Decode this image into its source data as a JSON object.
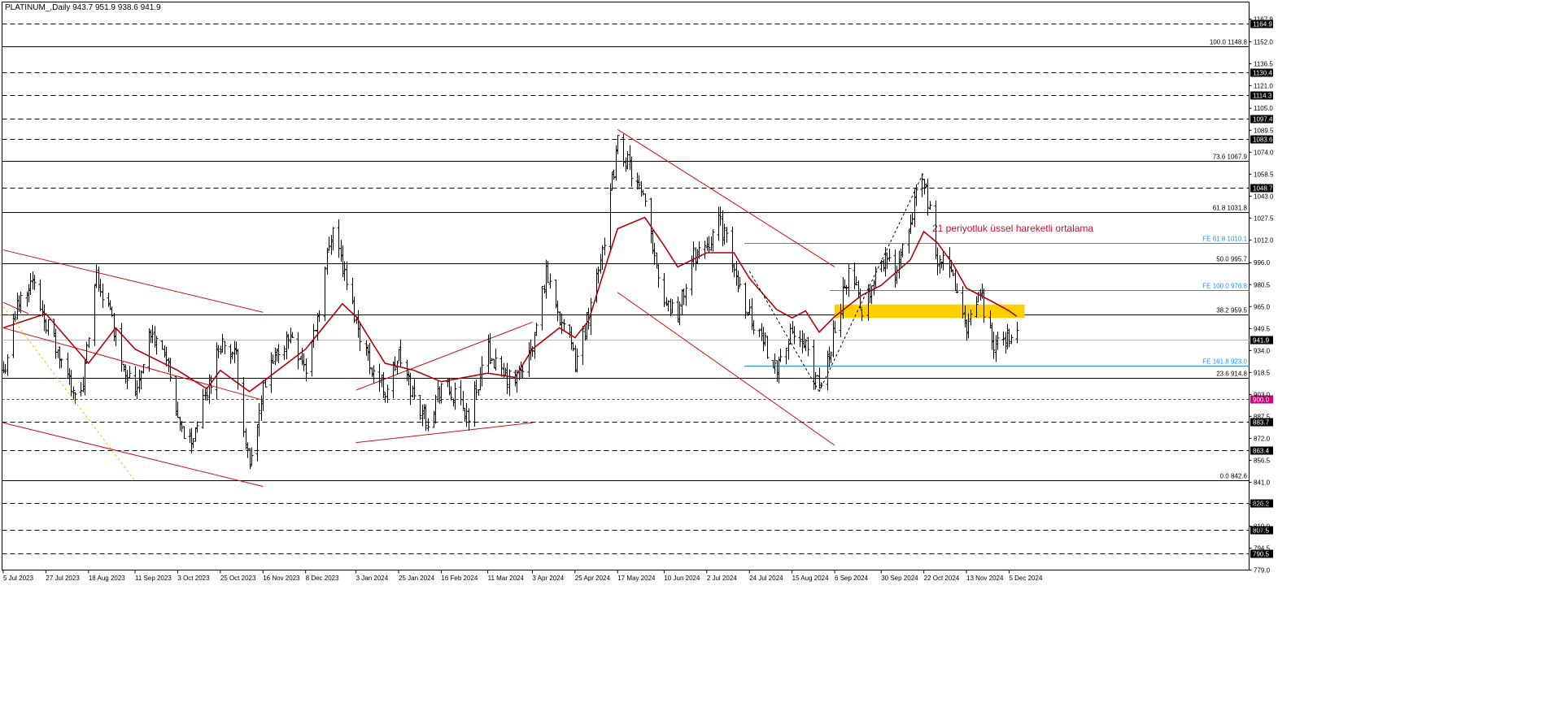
{
  "header": {
    "symbol_line": "PLATINUM_,Daily  943.7 951.9 938.6 941.9"
  },
  "annotation": "21 periyotluk üssel hareketli ortalama",
  "colors": {
    "price_bars": "#000000",
    "ema": "#b3000c",
    "trendlines": "#d01010",
    "fib": "#000000",
    "fe": "#1e90ff",
    "zone": "#ffd000",
    "level_900": "#d0007a"
  },
  "chart_data": {
    "type": "ohlc",
    "symbol": "PLATINUM_",
    "timeframe": "Daily",
    "last_bar": {
      "open": 943.7,
      "high": 951.9,
      "low": 938.6,
      "close": 941.9
    },
    "current_price": 941.9,
    "ylim": [
      779.0,
      1180.0
    ],
    "y_ticks": [
      "1167.9",
      "1152.0",
      "1136.5",
      "1121.0",
      "1105.0",
      "1089.5",
      "1074.0",
      "1058.5",
      "1043.0",
      "1027.5",
      "1012.0",
      "996.0",
      "980.5",
      "965.0",
      "949.5",
      "934.0",
      "918.5",
      "903.0",
      "887.5",
      "872.0",
      "856.5",
      "841.0",
      "825.5",
      "810.0",
      "794.5",
      "779.0"
    ],
    "x_ticks": [
      "5 Jul 2023",
      "27 Jul 2023",
      "18 Aug 2023",
      "11 Sep 2023",
      "3 Oct 2023",
      "25 Oct 2023",
      "16 Nov 2023",
      "8 Dec 2023",
      "3 Jan 2024",
      "25 Jan 2024",
      "16 Feb 2024",
      "11 Mar 2024",
      "3 Apr 2024",
      "25 Apr 2024",
      "17 May 2024",
      "10 Jun 2024",
      "2 Jul 2024",
      "24 Jul 2024",
      "15 Aug 2024",
      "6 Sep 2024",
      "30 Sep 2024",
      "22 Oct 2024",
      "13 Nov 2024",
      "5 Dec 2024"
    ],
    "price_path": [
      [
        "5 Jul 2023",
        918
      ],
      [
        "12 Jul 2023",
        965
      ],
      [
        "19 Jul 2023",
        985
      ],
      [
        "27 Jul 2023",
        955
      ],
      [
        "5 Aug 2023",
        920
      ],
      [
        "14 Aug 2023",
        900
      ],
      [
        "22 Aug 2023",
        985
      ],
      [
        "29 Aug 2023",
        960
      ],
      [
        "5 Sep 2023",
        925
      ],
      [
        "11 Sep 2023",
        905
      ],
      [
        "18 Sep 2023",
        945
      ],
      [
        "26 Sep 2023",
        935
      ],
      [
        "3 Oct 2023",
        880
      ],
      [
        "10 Oct 2023",
        870
      ],
      [
        "18 Oct 2023",
        905
      ],
      [
        "25 Oct 2023",
        940
      ],
      [
        "2 Nov 2023",
        928
      ],
      [
        "9 Nov 2023",
        848
      ],
      [
        "16 Nov 2023",
        905
      ],
      [
        "24 Nov 2023",
        935
      ],
      [
        "1 Dec 2023",
        945
      ],
      [
        "8 Dec 2023",
        920
      ],
      [
        "15 Dec 2023",
        965
      ],
      [
        "22 Dec 2023",
        1025
      ],
      [
        "29 Dec 2023",
        980
      ],
      [
        "3 Jan 2024",
        955
      ],
      [
        "10 Jan 2024",
        925
      ],
      [
        "18 Jan 2024",
        905
      ],
      [
        "25 Jan 2024",
        930
      ],
      [
        "2 Feb 2024",
        900
      ],
      [
        "9 Feb 2024",
        885
      ],
      [
        "16 Feb 2024",
        910
      ],
      [
        "23 Feb 2024",
        900
      ],
      [
        "1 Mar 2024",
        888
      ],
      [
        "11 Mar 2024",
        935
      ],
      [
        "18 Mar 2024",
        915
      ],
      [
        "25 Mar 2024",
        912
      ],
      [
        "3 Apr 2024",
        935
      ],
      [
        "10 Apr 2024",
        990
      ],
      [
        "17 Apr 2024",
        960
      ],
      [
        "25 Apr 2024",
        925
      ],
      [
        "2 May 2024",
        960
      ],
      [
        "10 May 2024",
        1015
      ],
      [
        "17 May 2024",
        1080
      ],
      [
        "24 May 2024",
        1060
      ],
      [
        "31 May 2024",
        1035
      ],
      [
        "10 Jun 2024",
        970
      ],
      [
        "17 Jun 2024",
        960
      ],
      [
        "25 Jun 2024",
        1000
      ],
      [
        "2 Jul 2024",
        1010
      ],
      [
        "9 Jul 2024",
        1025
      ],
      [
        "16 Jul 2024",
        990
      ],
      [
        "24 Jul 2024",
        960
      ],
      [
        "31 Jul 2024",
        940
      ],
      [
        "7 Aug 2024",
        925
      ],
      [
        "15 Aug 2024",
        945
      ],
      [
        "22 Aug 2024",
        935
      ],
      [
        "29 Aug 2024",
        905
      ],
      [
        "6 Sep 2024",
        950
      ],
      [
        "13 Sep 2024",
        990
      ],
      [
        "20 Sep 2024",
        965
      ],
      [
        "30 Sep 2024",
        1000
      ],
      [
        "7 Oct 2024",
        990
      ],
      [
        "15 Oct 2024",
        1030
      ],
      [
        "22 Oct 2024",
        1055
      ],
      [
        "29 Oct 2024",
        1000
      ],
      [
        "6 Nov 2024",
        985
      ],
      [
        "13 Nov 2024",
        945
      ],
      [
        "20 Nov 2024",
        975
      ],
      [
        "27 Nov 2024",
        935
      ],
      [
        "5 Dec 2024",
        945
      ],
      [
        "9 Dec 2024",
        941.9
      ]
    ],
    "ema_series": {
      "period": 21,
      "path": [
        [
          "5 Jul 2023",
          950
        ],
        [
          "27 Jul 2023",
          960
        ],
        [
          "18 Aug 2023",
          925
        ],
        [
          "1 Sep 2023",
          950
        ],
        [
          "11 Sep 2023",
          935
        ],
        [
          "3 Oct 2023",
          920
        ],
        [
          "18 Oct 2023",
          907
        ],
        [
          "25 Oct 2023",
          920
        ],
        [
          "9 Nov 2023",
          905
        ],
        [
          "16 Nov 2023",
          912
        ],
        [
          "8 Dec 2023",
          935
        ],
        [
          "27 Dec 2023",
          967
        ],
        [
          "3 Jan 2024",
          958
        ],
        [
          "18 Jan 2024",
          925
        ],
        [
          "2 Feb 2024",
          920
        ],
        [
          "16 Feb 2024",
          912
        ],
        [
          "11 Mar 2024",
          918
        ],
        [
          "25 Mar 2024",
          915
        ],
        [
          "3 Apr 2024",
          935
        ],
        [
          "17 Apr 2024",
          950
        ],
        [
          "25 Apr 2024",
          943
        ],
        [
          "2 May 2024",
          955
        ],
        [
          "10 May 2024",
          990
        ],
        [
          "17 May 2024",
          1020
        ],
        [
          "31 May 2024",
          1028
        ],
        [
          "10 Jun 2024",
          1008
        ],
        [
          "17 Jun 2024",
          993
        ],
        [
          "2 Jul 2024",
          1003
        ],
        [
          "16 Jul 2024",
          1003
        ],
        [
          "24 Jul 2024",
          985
        ],
        [
          "7 Aug 2024",
          963
        ],
        [
          "15 Aug 2024",
          957
        ],
        [
          "22 Aug 2024",
          962
        ],
        [
          "29 Aug 2024",
          947
        ],
        [
          "6 Sep 2024",
          958
        ],
        [
          "20 Sep 2024",
          973
        ],
        [
          "30 Sep 2024",
          980
        ],
        [
          "15 Oct 2024",
          998
        ],
        [
          "22 Oct 2024",
          1018
        ],
        [
          "29 Oct 2024",
          1010
        ],
        [
          "6 Nov 2024",
          995
        ],
        [
          "13 Nov 2024",
          978
        ],
        [
          "27 Nov 2024",
          968
        ],
        [
          "5 Dec 2024",
          962
        ],
        [
          "9 Dec 2024",
          958
        ]
      ]
    },
    "horizontal_levels": [
      {
        "value": 1148.8,
        "label": "100.0 1148.8",
        "style": "solid",
        "kind": "fib"
      },
      {
        "value": 1067.9,
        "label": "73.6 1067.9",
        "style": "solid",
        "kind": "fib"
      },
      {
        "value": 1031.8,
        "label": "61.8 1031.8",
        "style": "solid",
        "kind": "fib"
      },
      {
        "value": 995.7,
        "label": "50.0 995.7",
        "style": "solid",
        "kind": "fib"
      },
      {
        "value": 959.5,
        "label": "38.2 959.5",
        "style": "solid",
        "kind": "fib"
      },
      {
        "value": 914.8,
        "label": "23.6 914.8",
        "style": "solid",
        "kind": "fib"
      },
      {
        "value": 842.6,
        "label": "0.0 842.6",
        "style": "solid",
        "kind": "fib"
      },
      {
        "value": 1010.1,
        "label": "FE 61.8 1010.1",
        "style": "solid",
        "kind": "fe"
      },
      {
        "value": 976.8,
        "label": "FE 100.0 976.8",
        "style": "solid",
        "kind": "fe"
      },
      {
        "value": 923.0,
        "label": "FE 161.8 923.0",
        "style": "solid",
        "kind": "fe"
      },
      {
        "value": 1164.9,
        "label": "1164.9",
        "style": "dashed",
        "kind": "level"
      },
      {
        "value": 1130.4,
        "label": "1130.4",
        "style": "dashed",
        "kind": "level"
      },
      {
        "value": 1114.3,
        "label": "1114.3",
        "style": "dashed",
        "kind": "level"
      },
      {
        "value": 1097.4,
        "label": "1097.4",
        "style": "dashed",
        "kind": "level"
      },
      {
        "value": 1083.6,
        "label": "1083.6",
        "style": "dashed",
        "kind": "level"
      },
      {
        "value": 1048.7,
        "label": "1048.7",
        "style": "dashed",
        "kind": "level"
      },
      {
        "value": 900.0,
        "label": "900.0",
        "style": "dotted",
        "kind": "level900"
      },
      {
        "value": 883.7,
        "label": "883.7",
        "style": "dashed",
        "kind": "level"
      },
      {
        "value": 863.4,
        "label": "863.4",
        "style": "dashed",
        "kind": "level"
      },
      {
        "value": 826.2,
        "label": "826.2",
        "style": "dashed",
        "kind": "level"
      },
      {
        "value": 807.5,
        "label": "807.5",
        "style": "dashed",
        "kind": "level"
      },
      {
        "value": 790.5,
        "label": "790.5",
        "style": "dashed",
        "kind": "level"
      }
    ],
    "zone": {
      "from_date": "6 Sep 2024",
      "to_date": "13 Dec 2024",
      "low": 957.0,
      "high": 966.5
    },
    "trendlines": [
      {
        "from": [
          "5 Jul 2023",
          1005
        ],
        "to": [
          "16 Nov 2023",
          961
        ]
      },
      {
        "from": [
          "5 Jul 2023",
          950
        ],
        "to": [
          "16 Nov 2023",
          899
        ]
      },
      {
        "from": [
          "5 Jul 2023",
          883
        ],
        "to": [
          "16 Nov 2023",
          838
        ]
      },
      {
        "from": [
          "5 Jul 2023",
          968
        ],
        "to": [
          "18 Jul 2023",
          960
        ]
      },
      {
        "from": [
          "3 Jan 2024",
          906
        ],
        "to": [
          "3 Apr 2024",
          954
        ]
      },
      {
        "from": [
          "3 Jan 2024",
          869
        ],
        "to": [
          "3 Apr 2024",
          883
        ]
      },
      {
        "from": [
          "17 May 2024",
          1090
        ],
        "to": [
          "6 Sep 2024",
          993
        ]
      },
      {
        "from": [
          "17 May 2024",
          975
        ],
        "to": [
          "6 Sep 2024",
          867
        ]
      }
    ],
    "dotted_lines": [
      {
        "from": [
          "5 Jul 2023",
          965
        ],
        "to": [
          "11 Sep 2023",
          842
        ],
        "color": "#f2c200"
      },
      {
        "from": [
          "24 Jul 2024",
          990
        ],
        "to": [
          "29 Aug 2024",
          905
        ],
        "color": "#000000"
      },
      {
        "from": [
          "29 Aug 2024",
          905
        ],
        "to": [
          "22 Oct 2024",
          1060
        ],
        "color": "#000000"
      }
    ]
  }
}
